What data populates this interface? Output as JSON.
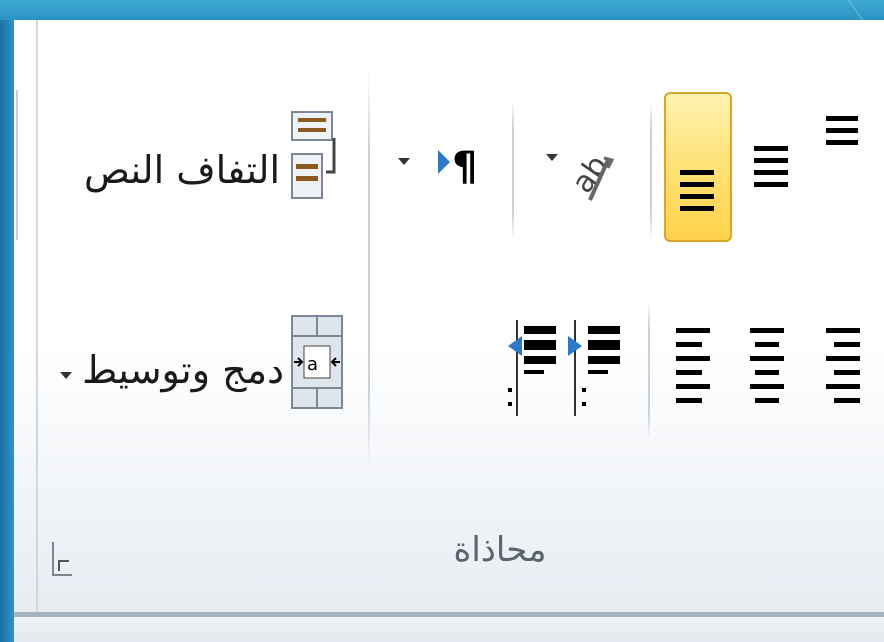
{
  "ribbon": {
    "group_label": "محاذاة",
    "wrap_text_label": "التفاف النص",
    "merge_center_label": "دمج وتوسيط"
  },
  "buttons": {
    "top_align": "top-align-icon",
    "middle_align": "middle-align-icon",
    "bottom_align": "bottom-align-icon",
    "orientation": "orientation-icon",
    "text_direction": "text-direction-icon",
    "align_right": "align-right-icon",
    "align_center": "align-center-icon",
    "align_left": "align-left-icon",
    "increase_indent": "increase-indent-icon",
    "decrease_indent": "decrease-indent-icon",
    "wrap_text": "wrap-text-icon",
    "merge_center": "merge-center-icon",
    "dialog_launcher": "dialog-launcher-icon"
  },
  "colors": {
    "selected_fill": "#ffd24a",
    "frame": "#2a8cbf"
  },
  "state": {
    "selected": "bottom_align"
  }
}
